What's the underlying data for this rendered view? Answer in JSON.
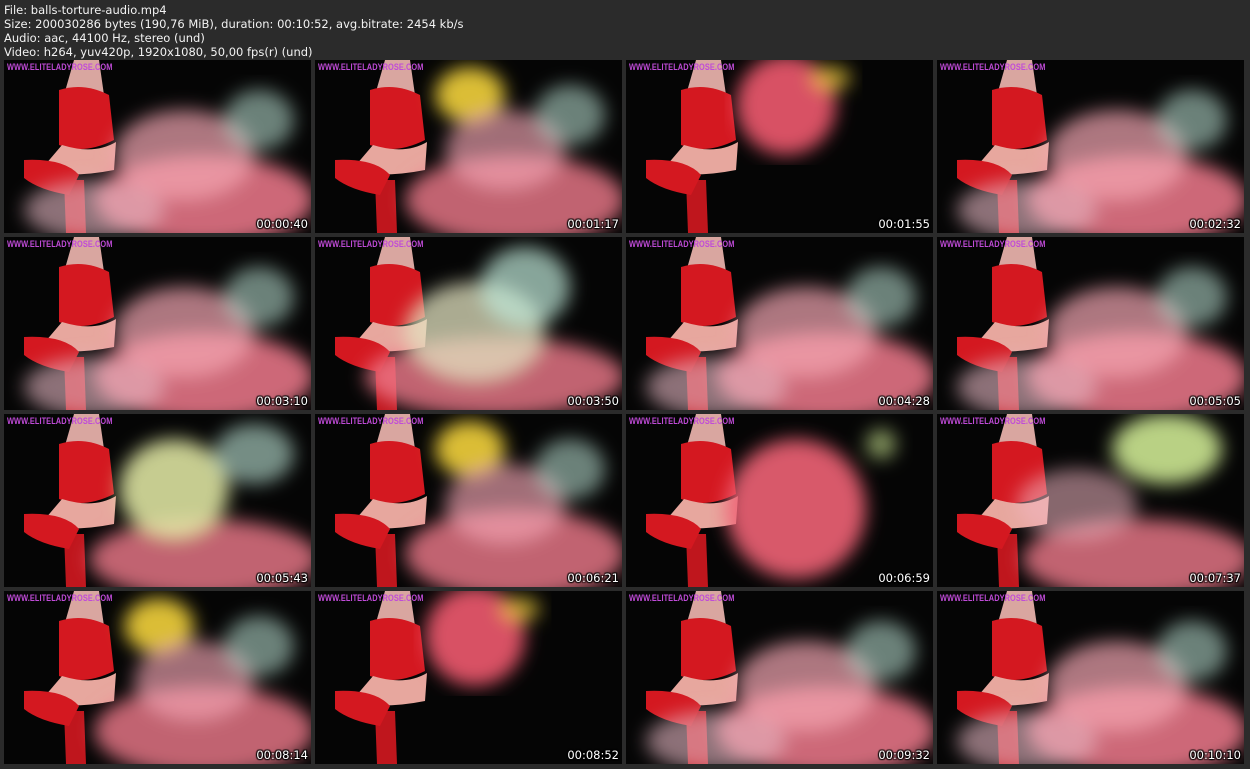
{
  "header": {
    "file_line": "File: balls-torture-audio.mp4",
    "size_line": "Size: 200030286 bytes (190,76 MiB), duration: 00:10:52, avg.bitrate: 2454 kb/s",
    "audio_line": "Audio: aac, 44100 Hz, stereo (und)",
    "video_line": "Video: h264, yuv420p, 1920x1080, 50,00 fps(r) (und)"
  },
  "watermark_text": "WWW.ELITELADYROSE.COM",
  "colors": {
    "background": "#2b2b2b",
    "watermark": "#c04bd8",
    "figure_red": "#d41820",
    "smoke_pink": "#f07a8c",
    "smoke_mint": "#bfe8d8",
    "smoke_yellow": "#f2d23a",
    "smoke_lime": "#d8f59a"
  },
  "thumbnails": [
    {
      "timestamp": "00:00:40",
      "variant": "pink-cloud"
    },
    {
      "timestamp": "00:01:17",
      "variant": "yellow-burst"
    },
    {
      "timestamp": "00:01:55",
      "variant": "pink-top"
    },
    {
      "timestamp": "00:02:32",
      "variant": "pink-cloud"
    },
    {
      "timestamp": "00:03:10",
      "variant": "pink-cloud"
    },
    {
      "timestamp": "00:03:50",
      "variant": "mint-cloud"
    },
    {
      "timestamp": "00:04:28",
      "variant": "pink-cloud"
    },
    {
      "timestamp": "00:05:05",
      "variant": "pink-cloud"
    },
    {
      "timestamp": "00:05:43",
      "variant": "lime-cloud"
    },
    {
      "timestamp": "00:06:21",
      "variant": "yellow-burst"
    },
    {
      "timestamp": "00:06:59",
      "variant": "pink-center"
    },
    {
      "timestamp": "00:07:37",
      "variant": "lime-top"
    },
    {
      "timestamp": "00:08:14",
      "variant": "yellow-burst"
    },
    {
      "timestamp": "00:08:52",
      "variant": "pink-top"
    },
    {
      "timestamp": "00:09:32",
      "variant": "pink-cloud"
    },
    {
      "timestamp": "00:10:10",
      "variant": "pink-cloud"
    }
  ]
}
